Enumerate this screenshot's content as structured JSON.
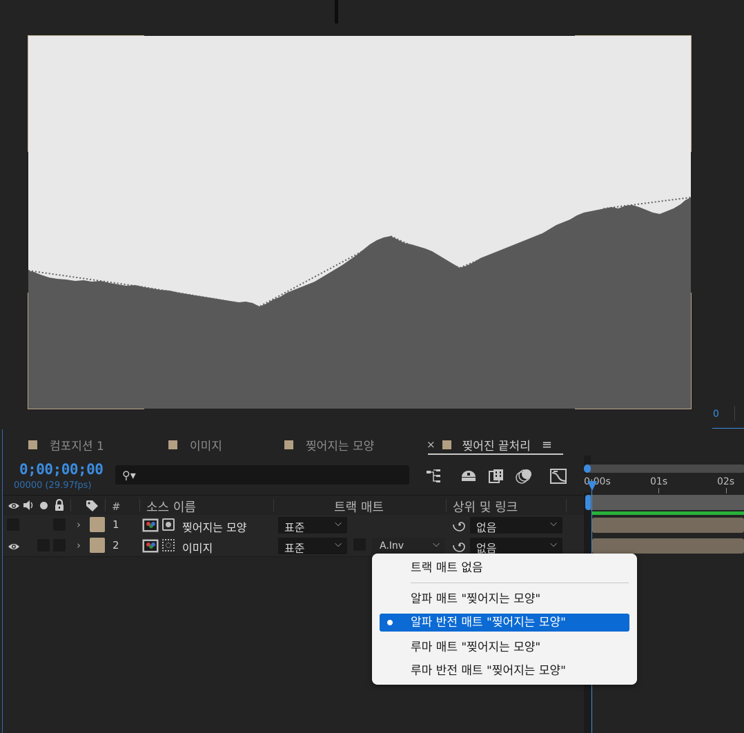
{
  "viewer": {
    "right_readout": "0"
  },
  "tabs": [
    {
      "label": "컴포지션 1"
    },
    {
      "label": "이미지"
    },
    {
      "label": "찢어지는 모양"
    },
    {
      "label": "찢어진 끝처리",
      "active": true
    }
  ],
  "tab_close": "×",
  "tab_menu": "≡",
  "timeline": {
    "timecode": "0;00;00;00",
    "fps": "00000 (29.97fps)",
    "search_placeholder": ""
  },
  "columns": {
    "number": "#",
    "source_name": "소스 이름",
    "track_matte": "트랙 매트",
    "parent_link": "상위 및 링크"
  },
  "layers": [
    {
      "index": "1",
      "name": "찢어지는 모양",
      "mode": "표준",
      "matte": "",
      "parent": "없음",
      "visible": false
    },
    {
      "index": "2",
      "name": "이미지",
      "mode": "표준",
      "matte": "A.Inv",
      "parent": "없음",
      "visible": true
    }
  ],
  "ruler": {
    "labels": [
      "0:00s",
      "01s",
      "02s"
    ]
  },
  "matte_menu": {
    "items": [
      {
        "label": "트랙 매트 없음"
      },
      {
        "label": "알파 매트 \"찢어지는 모양\""
      },
      {
        "label": "알파 반전 매트 \"찢어지는 모양\"",
        "selected": true
      },
      {
        "label": "루마 매트 \"찢어지는 모양\""
      },
      {
        "label": "루마 반전 매트 \"찢어지는 모양\""
      }
    ]
  },
  "colors": {
    "accent": "#3b8ce0",
    "label_swatch": "#b3a083",
    "menu_highlight": "#0b6ad3",
    "canvas_light": "#e8e8e8",
    "canvas_dark": "#595959",
    "green_bar": "#28b23a"
  }
}
